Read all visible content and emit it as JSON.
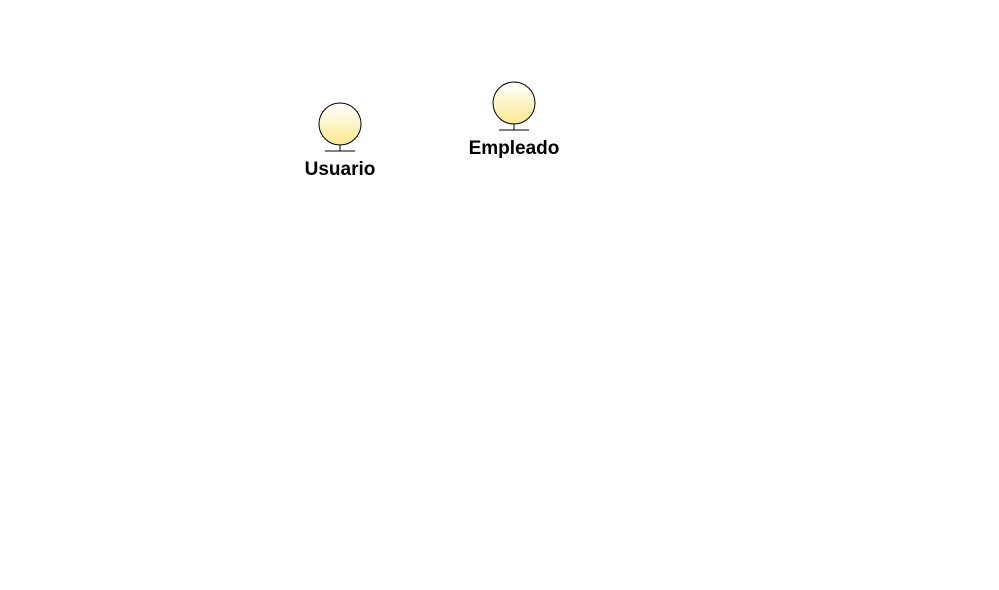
{
  "diagram": {
    "entities": [
      {
        "label": "Usuario",
        "icon": "entity-icon",
        "fill_top": "#ffffff",
        "fill_bottom": "#fbe98f",
        "stroke": "#000000"
      },
      {
        "label": "Empleado",
        "icon": "entity-icon",
        "fill_top": "#ffffff",
        "fill_bottom": "#fbe98f",
        "stroke": "#000000"
      }
    ]
  }
}
